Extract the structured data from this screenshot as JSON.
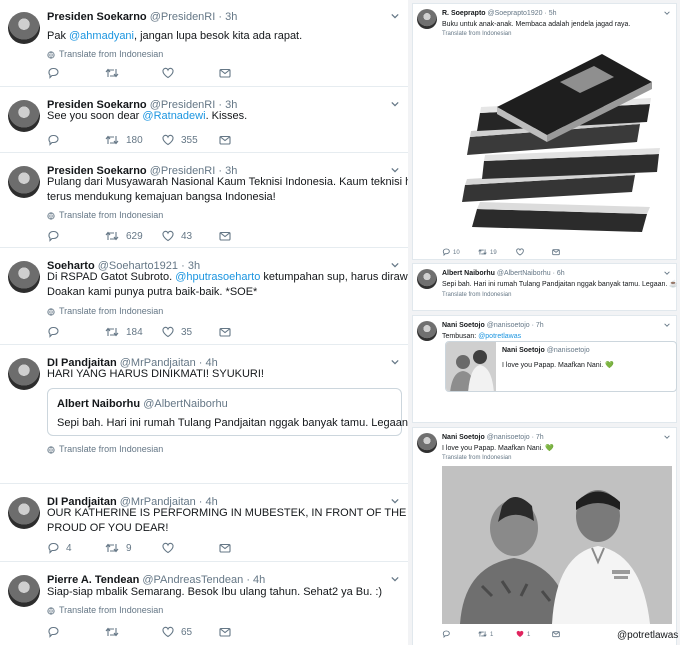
{
  "translate_label": "Translate from Indonesian",
  "tweets": [
    {
      "name": "Presiden Soekarno",
      "handle": "@PresidenRI",
      "dot": "·",
      "time": "3h",
      "text_parts": [
        "Pak ",
        "@ahmadyani",
        ", jangan lupa besok kita ada rapat."
      ],
      "retweets": "",
      "likes": ""
    },
    {
      "name": "Presiden Soekarno",
      "handle": "@PresidenRI",
      "dot": "·",
      "time": "3h",
      "text_parts": [
        "See you soon dear ",
        "@Ratnadewi",
        ". Kisses."
      ],
      "retweets": "180",
      "likes": "355"
    },
    {
      "name": "Presiden Soekarno",
      "handle": "@PresidenRI",
      "dot": "·",
      "time": "3h",
      "text_line1": "Pulang dari Musyawarah Nasional Kaum Teknisi Indonesia. Kaum teknisi harus",
      "text_line2": "terus mendukung kemajuan bangsa Indonesia!",
      "retweets": "629",
      "likes": "43"
    },
    {
      "name": "Soeharto",
      "handle": "@Soeharto1921",
      "dot": "·",
      "time": "3h",
      "text_parts": [
        "Di RSPAD Gatot Subroto. ",
        "@hputrasoeharto",
        " ketumpahan sup, harus dirawat."
      ],
      "text_line2": "Doakan kami punya putra baik-baik. *SOE*",
      "retweets": "184",
      "likes": "35"
    },
    {
      "name": "DI Pandjaitan",
      "handle": "@MrPandjaitan",
      "dot": "·",
      "time": "4h",
      "text": "HARI YANG HARUS DINIKMATI! SYUKURI!",
      "quote": {
        "name": "Albert Naiborhu",
        "handle": "@AlbertNaiborhu",
        "text": "Sepi bah. Hari ini rumah Tulang Pandjaitan nggak banyak tamu. Legaan. ☕"
      }
    },
    {
      "name": "DI Pandjaitan",
      "handle": "@MrPandjaitan",
      "dot": "·",
      "time": "4h",
      "text_line1": "OUR KATHERINE IS PERFORMING IN MUBESTEK, IN FRONT OF THE PRESIDENT.",
      "text_line2": "PROUD OF YOU DEAR!",
      "replies": "4",
      "retweets": "9",
      "likes": ""
    },
    {
      "name": "Pierre A. Tendean",
      "handle": "@PAndreasTendean",
      "dot": "·",
      "time": "4h",
      "text": "Siap-siap mbalik Semarang. Besok Ibu ulang tahun. Sehat2 ya Bu. :)",
      "retweets": "",
      "likes": "65"
    }
  ],
  "cards": [
    {
      "name": "R. Soeprapto",
      "handle": "@Soeprapto1920",
      "dot": "·",
      "time": "5h",
      "text": "Buku untuk anak-anak. Membaca adalah jendela jagad raya.",
      "replies": "10",
      "retweets": "19",
      "likes": ""
    },
    {
      "name": "Albert Naiborhu",
      "handle": "@AlbertNaiborhu",
      "dot": "·",
      "time": "6h",
      "text": "Sepi bah. Hari ini rumah Tulang Pandjaitan nggak banyak tamu. Legaan. ☕"
    },
    {
      "name": "Nani Soetojo",
      "handle": "@nanisoetojo",
      "dot": "·",
      "time": "7h",
      "text_prefix": "Tembusan: ",
      "mention": "@potretlawas",
      "inner": {
        "name": "Nani Soetojo",
        "handle": "@nanisoetojo",
        "text": "I love you Papap. Maafkan Nani. 💚"
      }
    },
    {
      "name": "Nani Soetojo",
      "handle": "@nanisoetojo",
      "dot": "·",
      "time": "7h",
      "text": "I love you Papap. Maafkan Nani. 💚",
      "retweets": "1",
      "likes": "1"
    }
  ],
  "watermark": "@potretlawas",
  "colors": {
    "link": "#1b95e0",
    "meta": "#657786",
    "border": "#e6ecf0",
    "like_active": "#e0245e"
  }
}
